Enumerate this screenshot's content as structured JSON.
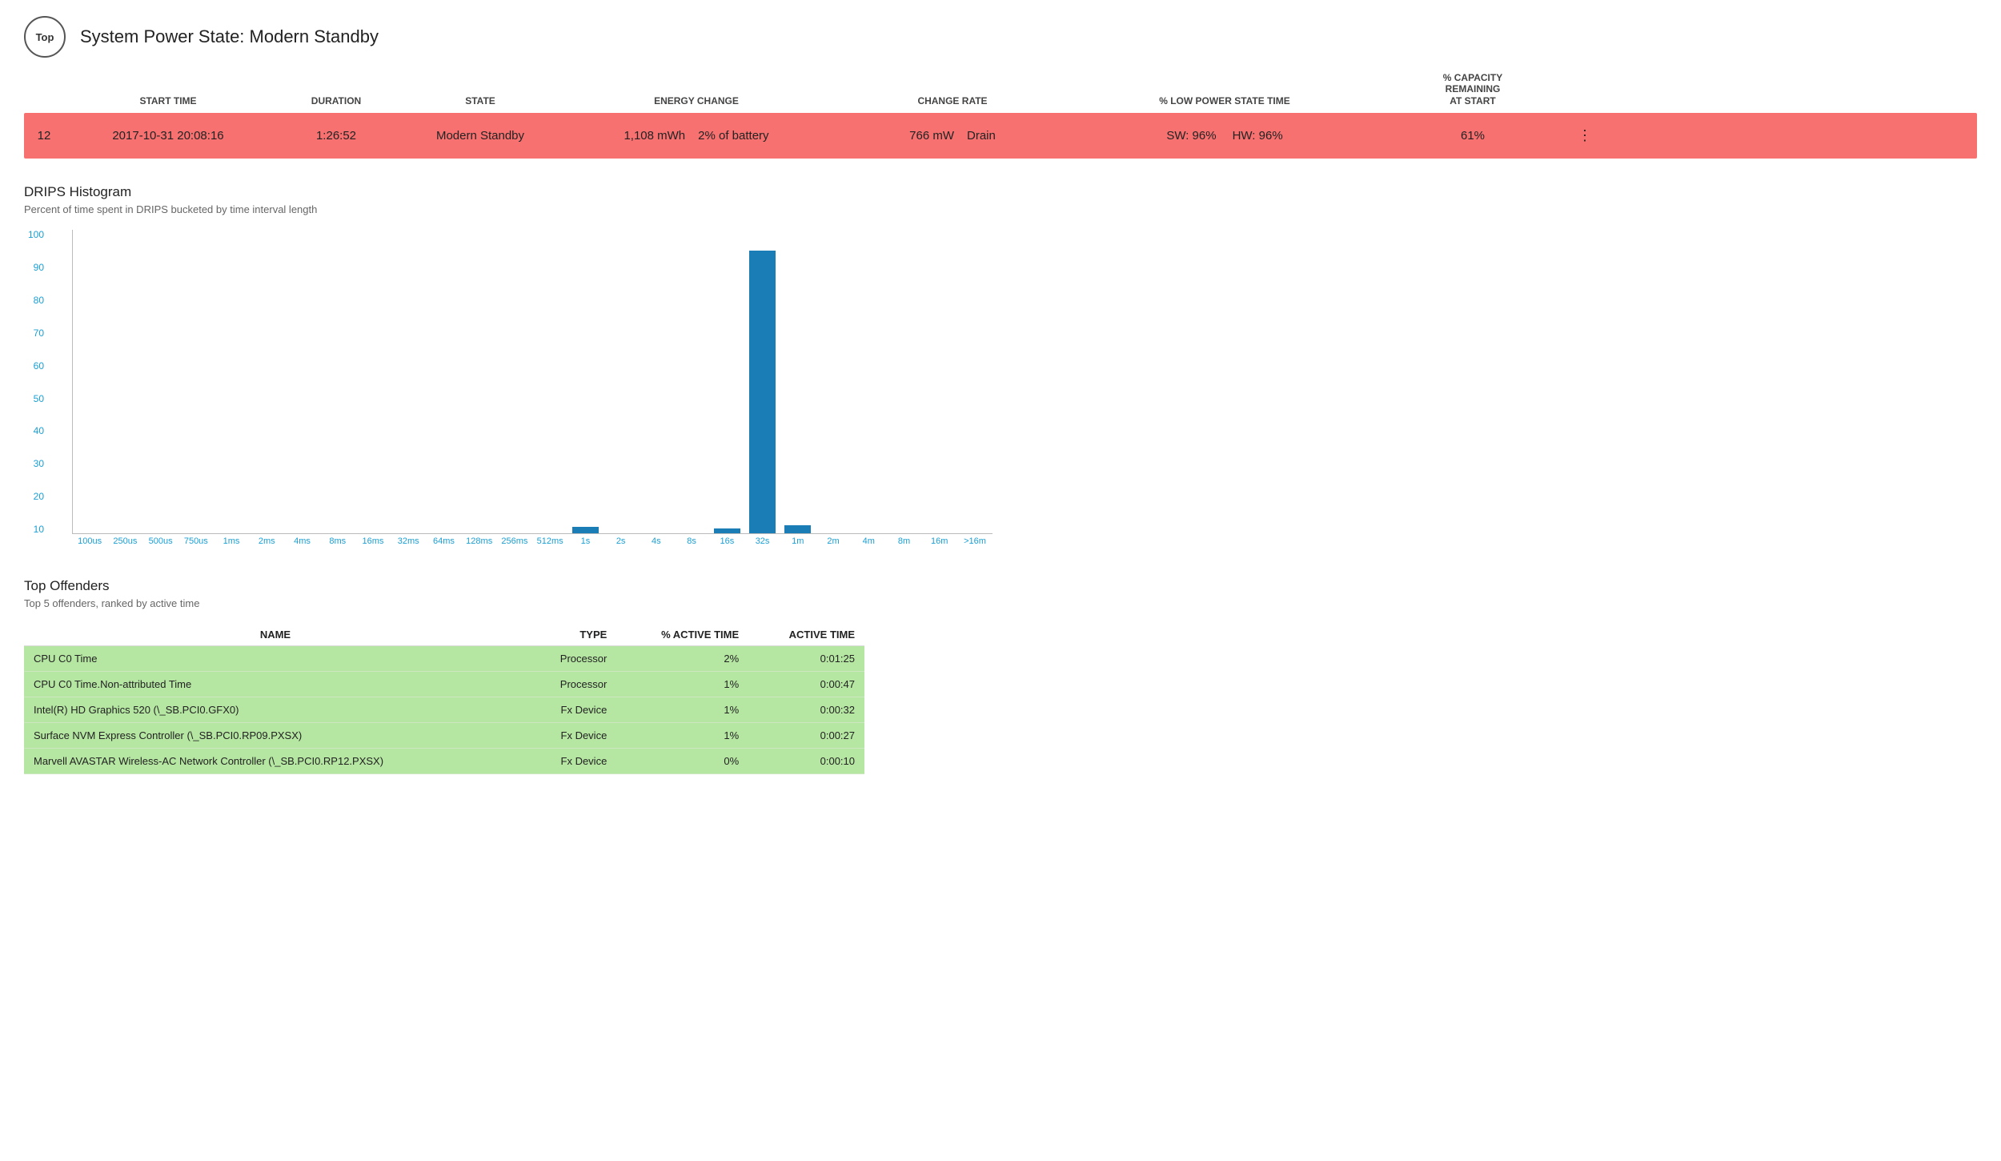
{
  "header": {
    "top_button_label": "Top",
    "title": "System Power State: Modern Standby"
  },
  "table": {
    "columns": [
      "",
      "START TIME",
      "DURATION",
      "STATE",
      "ENERGY CHANGE",
      "CHANGE RATE",
      "% LOW POWER STATE TIME",
      "% CAPACITY REMAINING AT START",
      ""
    ],
    "row": {
      "index": "12",
      "start_time": "2017-10-31  20:08:16",
      "duration": "1:26:52",
      "state": "Modern Standby",
      "energy_change_mwh": "1,108 mWh",
      "energy_change_pct": "2% of battery",
      "change_rate_mw": "766 mW",
      "change_rate_drain": "Drain",
      "low_power_sw": "SW: 96%",
      "low_power_hw": "HW: 96%",
      "capacity_remaining": "61%",
      "more": "⋮"
    }
  },
  "drips": {
    "title": "DRIPS Histogram",
    "subtitle": "Percent of time spent in DRIPS bucketed by time interval length",
    "y_labels": [
      "100",
      "90",
      "80",
      "70",
      "60",
      "50",
      "40",
      "30",
      "20",
      "10"
    ],
    "x_labels": [
      "100us",
      "250us",
      "500us",
      "750us",
      "1ms",
      "2ms",
      "4ms",
      "8ms",
      "16ms",
      "32ms",
      "64ms",
      "128ms",
      "256ms",
      "512ms",
      "1s",
      "2s",
      "4s",
      "8s",
      "16s",
      "32s",
      "1m",
      "2m",
      "4m",
      "8m",
      "16m",
      ">16m"
    ],
    "bars": {
      "100us": 0,
      "250us": 0,
      "500us": 0,
      "750us": 0,
      "1ms": 0,
      "2ms": 0,
      "4ms": 0,
      "8ms": 0,
      "16ms": 0,
      "32ms": 0,
      "64ms": 0,
      "128ms": 0,
      "256ms": 0,
      "512ms": 0,
      "1s": 2,
      "2s": 0,
      "4s": 0,
      "8s": 0,
      "16s": 1.5,
      "32s": 93,
      "1m": 2.5,
      "2m": 0,
      "4m": 0,
      "8m": 0,
      "16m": 0,
      ">16m": 0
    }
  },
  "offenders": {
    "title": "Top Offenders",
    "subtitle": "Top 5 offenders, ranked by active time",
    "columns": {
      "name": "NAME",
      "type": "TYPE",
      "pct_active": "% ACTIVE TIME",
      "active_time": "ACTIVE TIME"
    },
    "rows": [
      {
        "name": "CPU C0 Time",
        "type": "Processor",
        "pct_active": "2%",
        "active_time": "0:01:25"
      },
      {
        "name": "CPU C0 Time.Non-attributed Time",
        "type": "Processor",
        "pct_active": "1%",
        "active_time": "0:00:47"
      },
      {
        "name": "Intel(R) HD Graphics 520 (\\_SB.PCI0.GFX0)",
        "type": "Fx Device",
        "pct_active": "1%",
        "active_time": "0:00:32"
      },
      {
        "name": "Surface NVM Express Controller (\\_SB.PCI0.RP09.PXSX)",
        "type": "Fx Device",
        "pct_active": "1%",
        "active_time": "0:00:27"
      },
      {
        "name": "Marvell AVASTAR Wireless-AC Network Controller (\\_SB.PCI0.RP12.PXSX)",
        "type": "Fx Device",
        "pct_active": "0%",
        "active_time": "0:00:10"
      }
    ]
  }
}
